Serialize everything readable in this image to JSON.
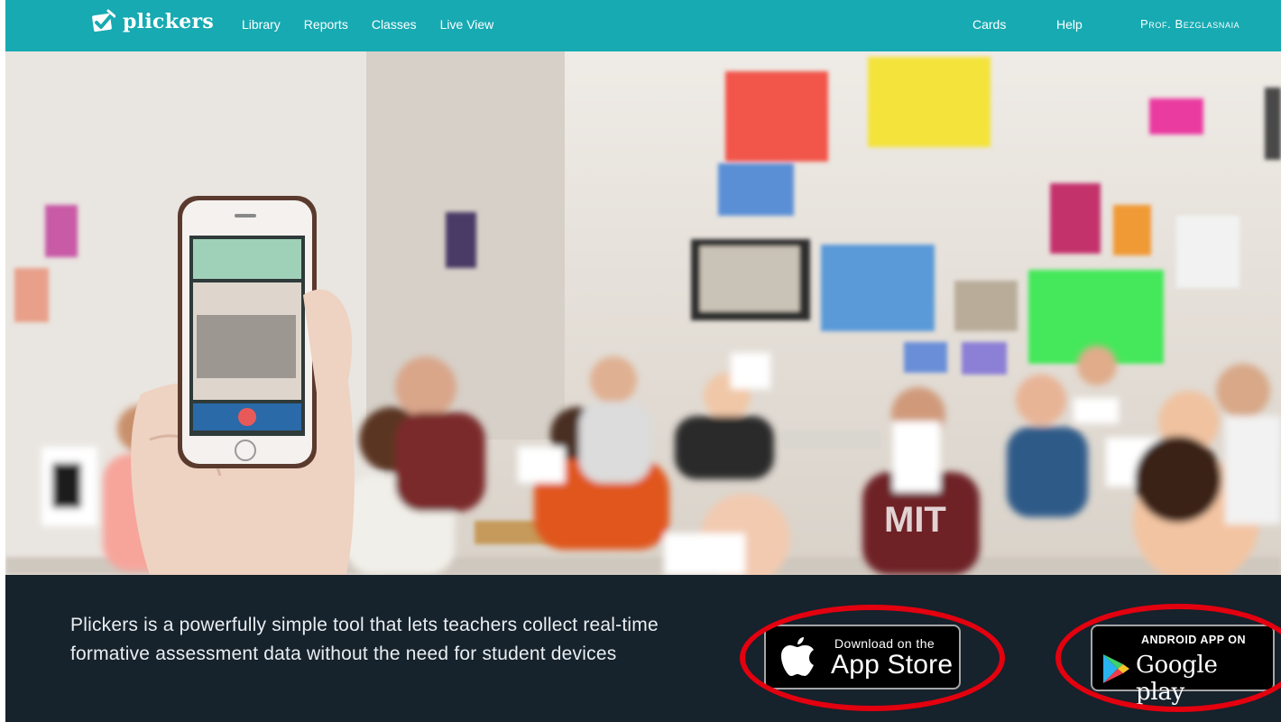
{
  "header": {
    "brand": "plickers",
    "nav_left": [
      "Library",
      "Reports",
      "Classes",
      "Live View"
    ],
    "nav_right": {
      "cards": "Cards",
      "help": "Help",
      "user": "Prof. Bezglasnaia"
    }
  },
  "colors": {
    "header_bg": "#17aab2",
    "footer_bg": "#16222c",
    "highlight_circle": "#e3000f"
  },
  "hero": {
    "photo_text": "MIT"
  },
  "footer": {
    "tagline": "Plickers is a powerfully simple tool that lets teachers collect real-time formative assessment data without the need for student devices",
    "app_store": {
      "small": "Download on the",
      "big": "App Store"
    },
    "google_play": {
      "small": "ANDROID APP ON",
      "big": "Google play"
    }
  }
}
